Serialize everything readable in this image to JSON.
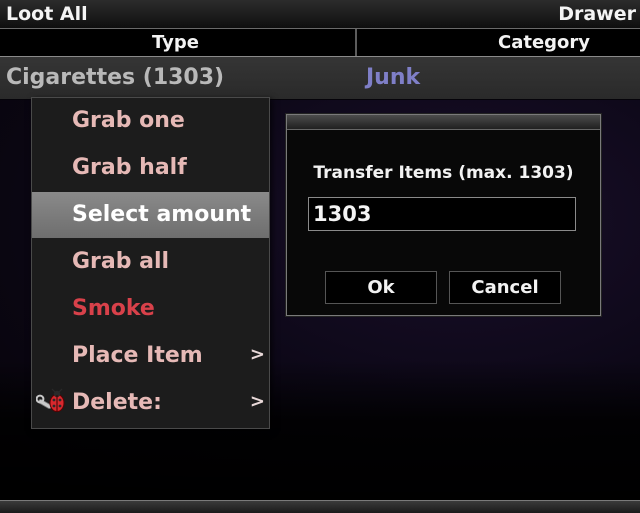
{
  "header": {
    "left_label": "Loot All",
    "right_label": "Drawer"
  },
  "columns": {
    "type": "Type",
    "category": "Category"
  },
  "list": {
    "rows": [
      {
        "name": "Cigarettes (1303)",
        "category": "Junk"
      }
    ]
  },
  "context_menu": {
    "items": [
      {
        "label": "Grab one",
        "color": "#e6b9b6",
        "arrow": ""
      },
      {
        "label": "Grab half",
        "color": "#e6b9b6",
        "arrow": ""
      },
      {
        "label": "Select amount",
        "color": "#ffffff",
        "arrow": "",
        "selected": true
      },
      {
        "label": "Grab all",
        "color": "#e6b9b6",
        "arrow": ""
      },
      {
        "label": "Smoke",
        "color": "#d8414a",
        "arrow": ""
      },
      {
        "label": "Place Item",
        "color": "#e6b9b6",
        "arrow": ">"
      },
      {
        "label": "Delete:",
        "color": "#e6b9b6",
        "arrow": ">",
        "icon": "bug-wrench-icon"
      }
    ]
  },
  "dialog": {
    "title": "Transfer Items (max. 1303)",
    "input_value": "1303",
    "ok_label": "Ok",
    "cancel_label": "Cancel"
  },
  "colors": {
    "category_text": "#7f7fc8",
    "smoke_text": "#d8414a",
    "selected_bg": "#7d7d7d"
  }
}
